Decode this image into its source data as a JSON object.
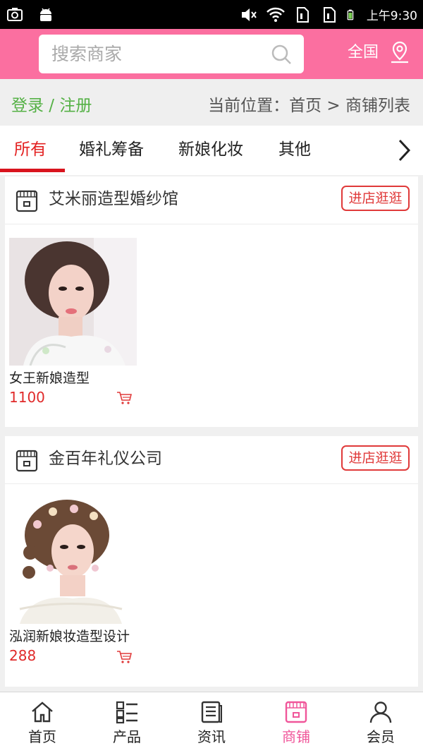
{
  "status_bar": {
    "time": "上午9:30"
  },
  "header": {
    "search_placeholder": "搜索商家",
    "region": "全国"
  },
  "crumbs": {
    "login": "登录 / 注册",
    "location": "当前位置：首页 > 商铺列表"
  },
  "tabs": [
    {
      "label": "所有",
      "active": true
    },
    {
      "label": "婚礼筹备"
    },
    {
      "label": "新娘化妆"
    },
    {
      "label": "其他"
    }
  ],
  "stores": [
    {
      "name": "艾米丽造型婚纱馆",
      "visit_label": "进店逛逛",
      "product": {
        "name": "女王新娘造型",
        "price": "1100"
      }
    },
    {
      "name": "金百年礼仪公司",
      "visit_label": "进店逛逛",
      "product": {
        "name": "泓润新娘妆造型设计",
        "price": "288"
      }
    }
  ],
  "bottom_nav": [
    {
      "label": "首页",
      "icon": "home-icon"
    },
    {
      "label": "产品",
      "icon": "grid-list-icon"
    },
    {
      "label": "资讯",
      "icon": "news-icon"
    },
    {
      "label": "商铺",
      "icon": "store-icon",
      "active": true
    },
    {
      "label": "会员",
      "icon": "user-icon"
    }
  ],
  "colors": {
    "brand_pink": "#fb6fa0",
    "active_red": "#e32121",
    "login_green": "#55b146",
    "price_red": "#e02a2a"
  }
}
